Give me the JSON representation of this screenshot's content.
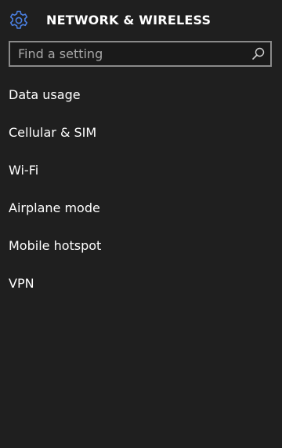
{
  "header": {
    "title": "NETWORK & WIRELESS",
    "icon": "gear-icon",
    "accent_color": "#4a7fe0"
  },
  "search": {
    "placeholder": "Find a setting",
    "value": "",
    "icon": "search-icon"
  },
  "menu": {
    "items": [
      {
        "label": "Data usage"
      },
      {
        "label": "Cellular & SIM"
      },
      {
        "label": "Wi-Fi"
      },
      {
        "label": "Airplane mode"
      },
      {
        "label": "Mobile hotspot"
      },
      {
        "label": "VPN"
      }
    ]
  }
}
